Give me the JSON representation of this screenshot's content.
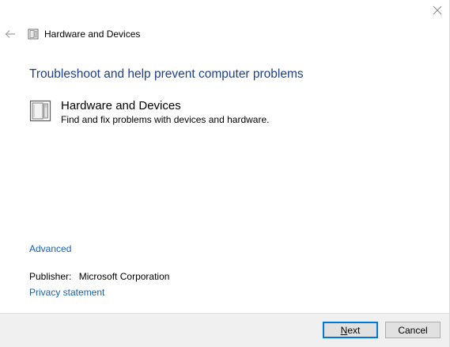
{
  "window": {
    "header_title": "Hardware and Devices",
    "close_glyph": "✕"
  },
  "main": {
    "heading": "Troubleshoot and help prevent computer problems",
    "troubleshooter": {
      "title": "Hardware and Devices",
      "description": "Find and fix problems with devices and hardware.",
      "icon": "hardware-device-icon"
    },
    "advanced_link": "Advanced",
    "publisher_label": "Publisher:",
    "publisher_value": "Microsoft Corporation",
    "privacy_link": "Privacy statement"
  },
  "footer": {
    "next_accel": "N",
    "next_rest": "ext",
    "cancel_label": "Cancel"
  },
  "colors": {
    "heading": "#1e3f8a",
    "link": "#1a5fb4",
    "footer_bg": "#f0f0f0",
    "default_button_border": "#0078d7"
  }
}
